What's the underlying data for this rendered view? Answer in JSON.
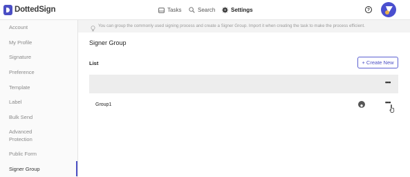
{
  "app": {
    "logo_text": "DottedSign"
  },
  "nav": {
    "tasks": {
      "label": "Tasks",
      "icon": "tasks-icon"
    },
    "search": {
      "label": "Search",
      "icon": "search-icon"
    },
    "settings": {
      "label": "Settings",
      "icon": "gear-icon"
    }
  },
  "header_actions": {
    "help_icon": "?"
  },
  "sidebar": {
    "items": [
      {
        "label": "Account"
      },
      {
        "label": "My Profile"
      },
      {
        "label": "Signature"
      },
      {
        "label": "Preference"
      },
      {
        "label": "Template"
      },
      {
        "label": "Label"
      },
      {
        "label": "Bulk Send"
      },
      {
        "label": "Advanced"
      },
      {
        "label": "Protection"
      },
      {
        "label": "Public Form"
      },
      {
        "label": "Signer Group"
      }
    ],
    "active": "Signer Group"
  },
  "banner": {
    "text": "You can group the commonly used signing process and create a Signer Group. Import it when creating the task to make the process efficient."
  },
  "main": {
    "title": "Signer Group",
    "list_label": "List",
    "create_button": "+ Create New",
    "rows": [
      {
        "name": "Group1"
      }
    ]
  },
  "colors": {
    "accent": "#4b4fc4",
    "header_bg": "#ededed",
    "banner_bg": "#f3f3f3"
  }
}
